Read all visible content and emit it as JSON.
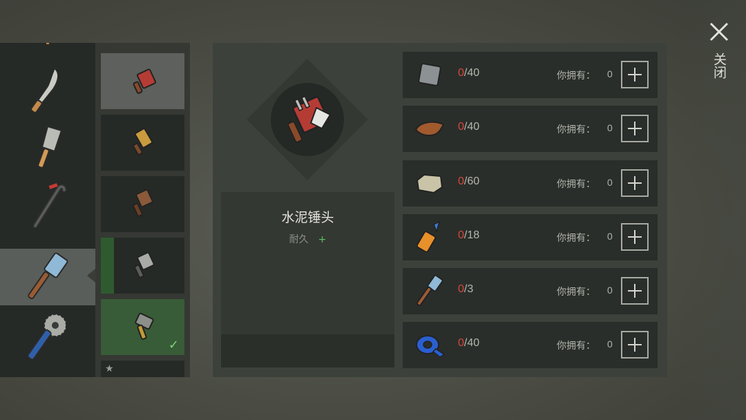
{
  "tools": [
    {
      "name": "machete-icon"
    },
    {
      "name": "cleaver-icon"
    },
    {
      "name": "crowbar-icon"
    },
    {
      "name": "sledgehammer-icon",
      "selected": true
    },
    {
      "name": "saw-mace-icon"
    }
  ],
  "variants": [
    {
      "name": "cement-hammer-icon",
      "state": "active"
    },
    {
      "name": "wrapped-hammer-icon",
      "state": "normal"
    },
    {
      "name": "wood-hammer-icon",
      "state": "normal"
    },
    {
      "name": "steel-hammer-icon",
      "state": "progress"
    },
    {
      "name": "iron-hammer-icon",
      "state": "done"
    },
    {
      "name": "locked-hammer-icon",
      "state": "starred"
    }
  ],
  "item": {
    "name": "水泥锤头",
    "durability_label": "耐久",
    "durability_plus": "+"
  },
  "resources": [
    {
      "icon": "metal-plate-icon",
      "have": "0",
      "need": "/40",
      "owned_label": "你拥有：",
      "owned": "0"
    },
    {
      "icon": "leather-icon",
      "have": "0",
      "need": "/40",
      "owned_label": "你拥有：",
      "owned": "0"
    },
    {
      "icon": "stone-icon",
      "have": "0",
      "need": "/60",
      "owned_label": "你拥有：",
      "owned": "0"
    },
    {
      "icon": "glue-icon",
      "have": "0",
      "need": "/18",
      "owned_label": "你拥有：",
      "owned": "0"
    },
    {
      "icon": "hammer-icon",
      "have": "0",
      "need": "/3",
      "owned_label": "你拥有：",
      "owned": "0"
    },
    {
      "icon": "tape-icon",
      "have": "0",
      "need": "/40",
      "owned_label": "你拥有：",
      "owned": "0"
    }
  ],
  "close": {
    "label": "关闭"
  },
  "colors": {
    "have": "#d9463c",
    "plus": "#5cc25a",
    "check": "#7fd37b"
  }
}
